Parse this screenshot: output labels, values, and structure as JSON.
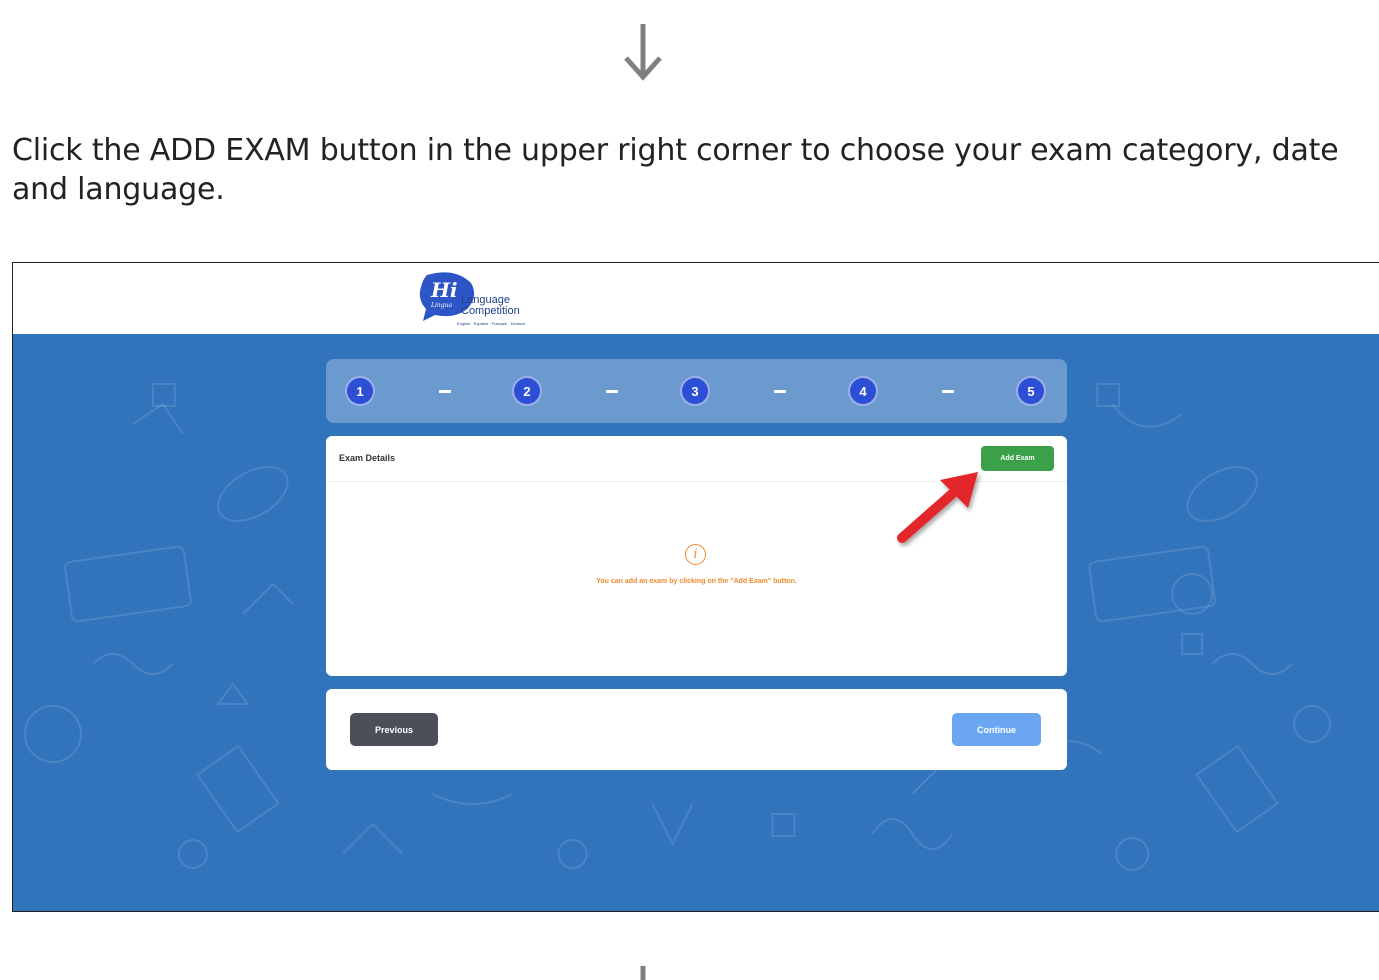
{
  "instruction": {
    "text": "Click the ADD EXAM button in the upper right corner to choose your exam category, date and language."
  },
  "logo": {
    "badge_text": "Hi",
    "badge_subtext": "Lingua",
    "title_line1": "Language",
    "title_line2": "Competition",
    "languages": "English · Español · Français · Deutsch"
  },
  "stepper": {
    "steps": [
      "1",
      "2",
      "3",
      "4",
      "5"
    ]
  },
  "exam_card": {
    "title": "Exam Details",
    "add_button_label": "Add Exam",
    "empty_message": "You can add an exam by clicking on the \"Add Exam\" button.",
    "info_icon_glyph": "i"
  },
  "navigation": {
    "previous_label": "Previous",
    "continue_label": "Continue"
  },
  "colors": {
    "background_blue": "#3274bc",
    "step_blue": "#2d4fd6",
    "add_button_green": "#3aa149",
    "info_orange": "#f08a2c",
    "previous_gray": "#4a4f59",
    "continue_light_blue": "#6aa6f2",
    "pointer_red": "#e3262b"
  },
  "icons": {
    "top_arrow": "arrow-down-icon",
    "bottom_arrow": "arrow-down-icon",
    "pointer": "red-pointer-arrow-icon",
    "info": "info-circle-icon"
  }
}
